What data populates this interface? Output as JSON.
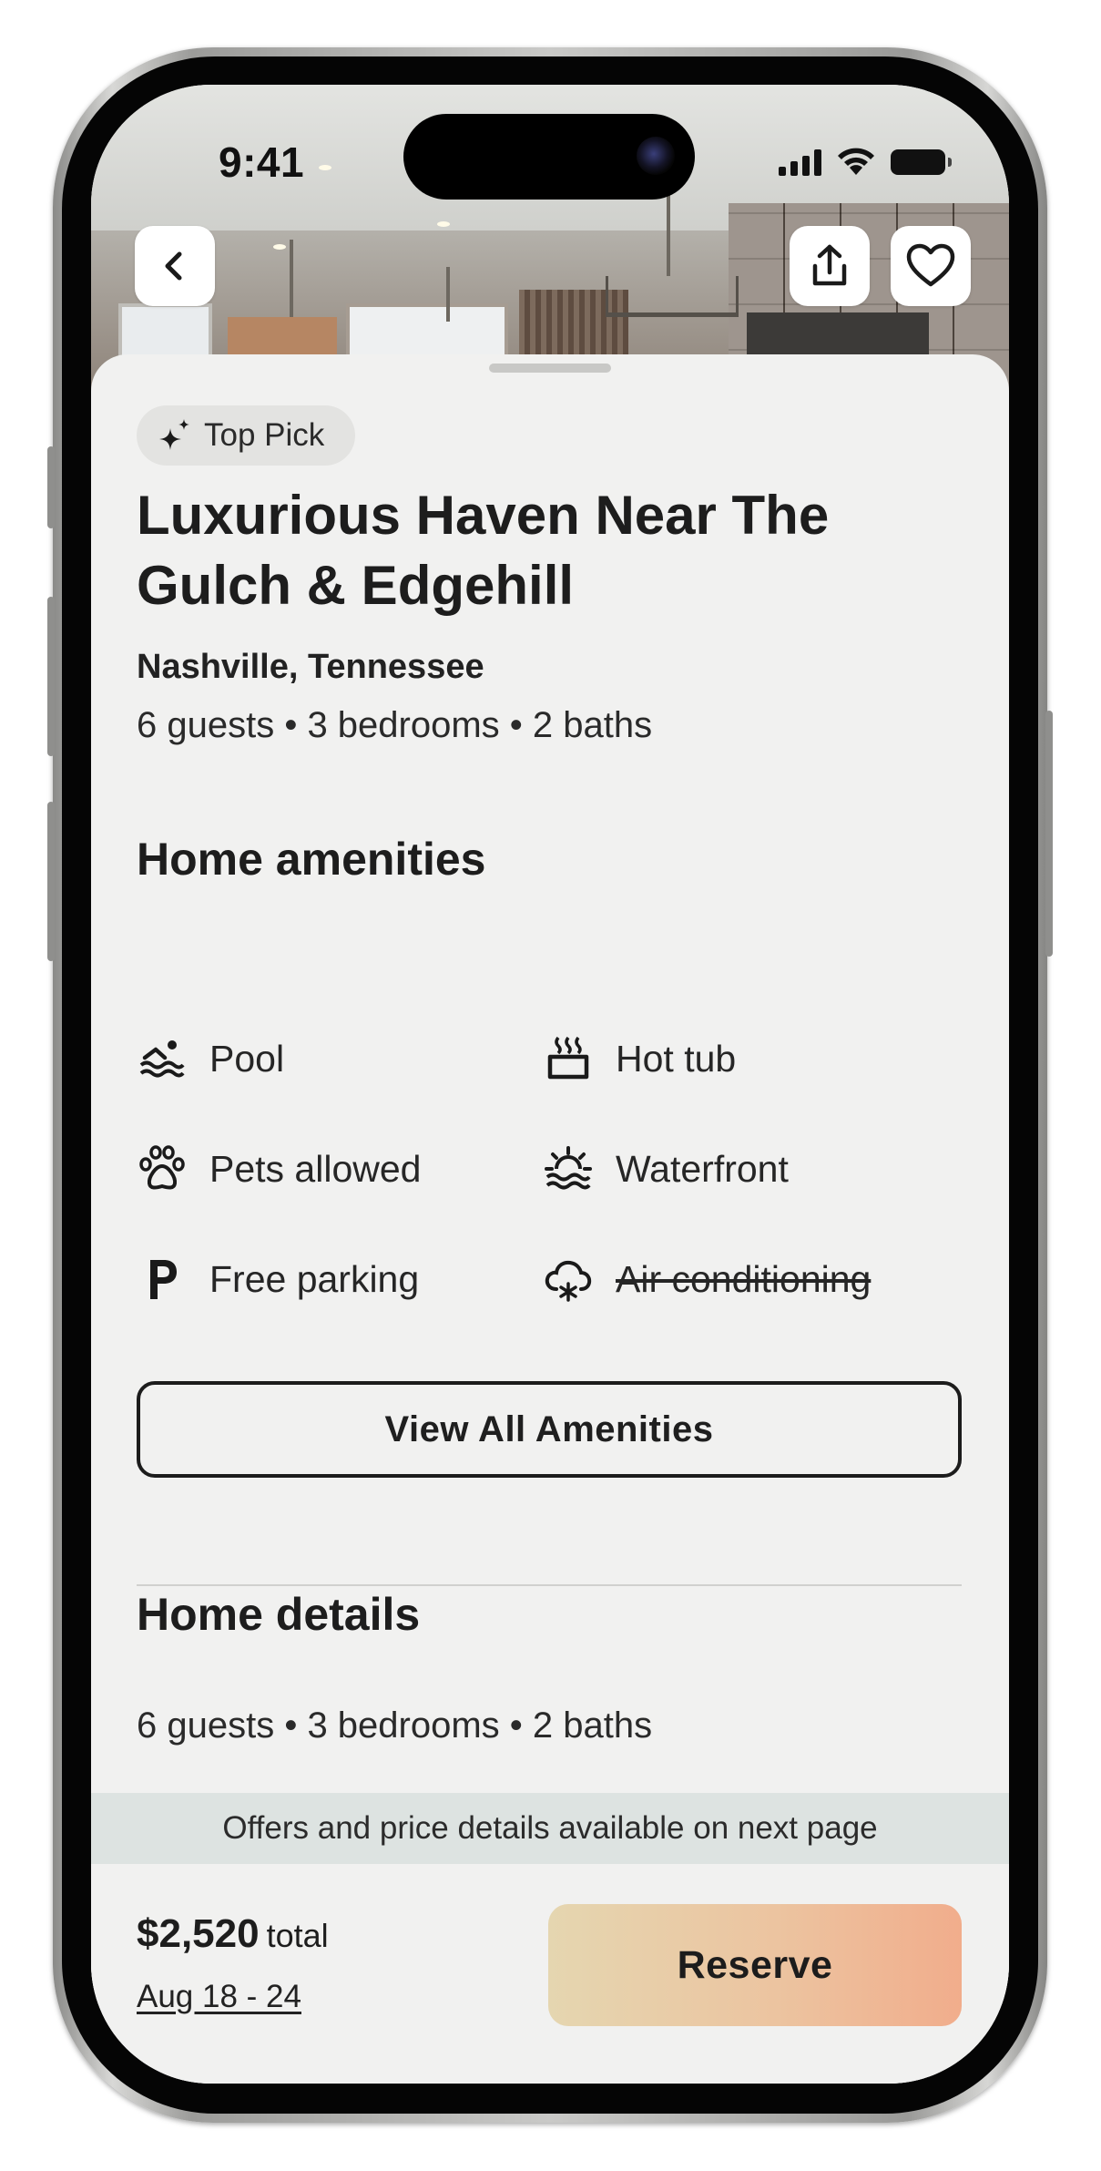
{
  "status_bar": {
    "time": "9:41"
  },
  "hero": {
    "back_icon": "chevron-left-icon",
    "share_icon": "share-icon",
    "favorite_icon": "heart-icon"
  },
  "listing": {
    "badge": "Top Pick",
    "badge_icon": "sparkle-icon",
    "title": "Luxurious Haven Near The Gulch & Edgehill",
    "location": "Nashville, Tennessee",
    "summary": "6 guests • 3 bedrooms • 2 baths"
  },
  "amenities": {
    "heading": "Home amenities",
    "items": [
      {
        "label": "Pool",
        "icon": "pool-icon",
        "available": true
      },
      {
        "label": "Hot tub",
        "icon": "hot-tub-icon",
        "available": true
      },
      {
        "label": "Pets allowed",
        "icon": "paw-icon",
        "available": true
      },
      {
        "label": "Waterfront",
        "icon": "waterfront-icon",
        "available": true
      },
      {
        "label": "Free parking",
        "icon": "parking-icon",
        "available": true
      },
      {
        "label": "Air conditioning",
        "icon": "air-conditioning-icon",
        "available": false
      }
    ],
    "view_all_label": "View All Amenities"
  },
  "details": {
    "heading": "Home details",
    "summary": "6 guests • 3 bedrooms • 2 baths"
  },
  "notice": "Offers and price details available on next page",
  "footer": {
    "price": "$2,520",
    "price_suffix": "total",
    "dates": "Aug 18 - 24",
    "reserve_label": "Reserve"
  },
  "colors": {
    "sheet_background": "#f1f1f0",
    "notice_background": "#dde3e1",
    "reserve_gradient_start": "#e5d6b0",
    "reserve_gradient_end": "#f1ad8c"
  }
}
